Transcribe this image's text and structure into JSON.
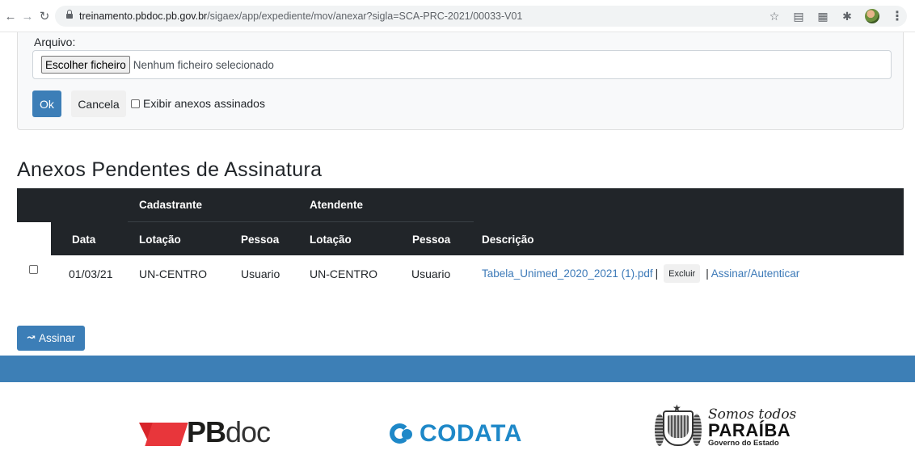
{
  "browser": {
    "url_host": "treinamento.pbdoc.pb.gov.br",
    "url_path": "/sigaex/app/expediente/mov/anexar?sigla=SCA-PRC-2021/00033-V01",
    "icons": [
      "back-arrow-icon",
      "forward-arrow-icon",
      "reload-icon",
      "lock-icon",
      "star-icon",
      "reader-icon",
      "grid-icon",
      "puzzle-icon",
      "avatar-icon",
      "menu-icon"
    ]
  },
  "upload_form": {
    "label": "Arquivo:",
    "file_button": "Escolher ficheiro",
    "file_status": "Nenhum ficheiro selecionado",
    "ok_label": "Ok",
    "cancel_label": "Cancela",
    "checkbox_label": "Exibir anexos assinados"
  },
  "section": {
    "title": "Anexos Pendentes de Assinatura"
  },
  "table": {
    "group_headers": {
      "cadastrante": "Cadastrante",
      "atendente": "Atendente"
    },
    "columns": {
      "data": "Data",
      "cad_lotacao": "Lotação",
      "cad_pessoa": "Pessoa",
      "at_lotacao": "Lotação",
      "at_pessoa": "Pessoa",
      "descricao": "Descrição"
    },
    "rows": [
      {
        "data": "01/03/21",
        "cad_lotacao": "UN-CENTRO",
        "cad_pessoa": "Usuario",
        "at_lotacao": "UN-CENTRO",
        "at_pessoa": "Usuario",
        "file_link": "Tabela_Unimed_2020_2021 (1).pdf",
        "excluir": "Excluir",
        "assinar_link": "Assinar/Autenticar"
      }
    ]
  },
  "actions": {
    "assinar_icon": "↝",
    "assinar_label": "Assinar"
  },
  "footer": {
    "bar_color": "#3d7fb6",
    "logos": {
      "pbdoc_bold": "PB",
      "pbdoc_light": "doc",
      "codata": "CODATA",
      "pb_somos": "Somos todos",
      "pb_name": "PARAÍBA",
      "pb_gov": "Governo do Estado"
    }
  },
  "colors": {
    "primary": "#3c7eb7",
    "table_header": "#212529",
    "link": "#3d7ab8"
  }
}
